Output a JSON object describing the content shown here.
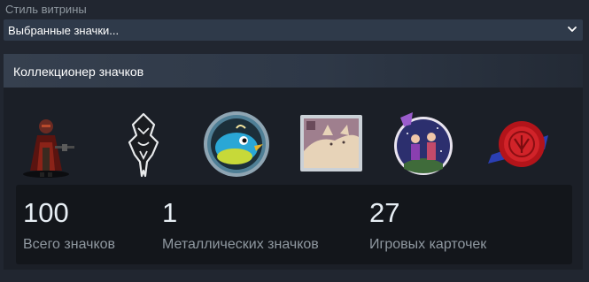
{
  "showcase": {
    "style_label": "Стиль витрины",
    "selected_style": "Выбранные значки..."
  },
  "panel": {
    "title": "Коллекционер значков",
    "badges": [
      {
        "name": "star-lord-badge-icon"
      },
      {
        "name": "skyrim-dragon-badge-icon"
      },
      {
        "name": "blue-bird-badge-icon"
      },
      {
        "name": "cat-card-badge-icon"
      },
      {
        "name": "pixel-witch-badge-icon"
      },
      {
        "name": "red-wax-seal-badge-icon"
      }
    ],
    "stats": [
      {
        "value": "100",
        "label": "Всего значков"
      },
      {
        "value": "1",
        "label": "Металлических значков"
      },
      {
        "value": "27",
        "label": "Игровых карточек"
      }
    ]
  },
  "colors": {
    "background": "#212630",
    "select_bg": "#2f3a4a",
    "panel_bg": "#1b1f27",
    "stats_bg": "#13161b",
    "muted_text": "#8f98a0"
  }
}
